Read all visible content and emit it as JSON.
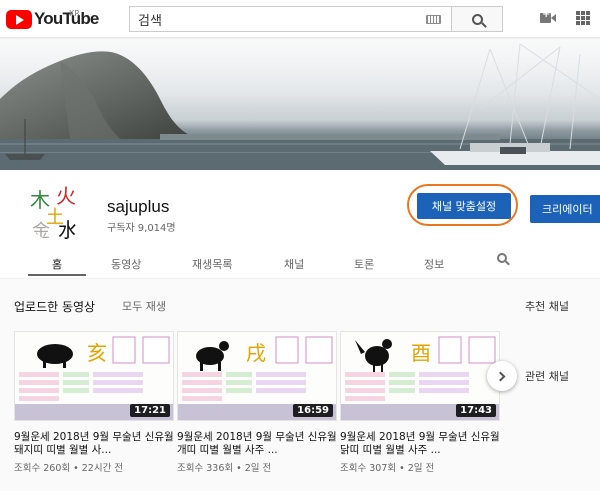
{
  "header": {
    "logo_text": "YouTube",
    "region": "KR",
    "search_placeholder": "검색"
  },
  "channel": {
    "name": "sajuplus",
    "subscribers": "구독자 9,014명",
    "avatar_chars": [
      "木",
      "火",
      "土",
      "金",
      "水"
    ],
    "customize_button": "채널 맞춤설정",
    "creator_button": "크리에이터"
  },
  "tabs": [
    "홈",
    "동영상",
    "재생목록",
    "채널",
    "토론",
    "정보"
  ],
  "section": {
    "title": "업로드한 동영상",
    "play_all": "모두 재생"
  },
  "sidebar": {
    "featured_channels": "추천 채널",
    "related_channels": "관련 채널"
  },
  "videos": [
    {
      "title": "9월운세 2018년 9월 무술년 신유월 돼지띠 띠별 월별 사...",
      "meta": "조회수 260회 • 22시간 전",
      "duration": "17:21",
      "animal": "pig",
      "char": "亥"
    },
    {
      "title": "9월운세 2018년 9월 무술년 신유월 개띠 띠별 월별 사주 ...",
      "meta": "조회수 336회 • 2일 전",
      "duration": "16:59",
      "animal": "dog",
      "char": "戌"
    },
    {
      "title": "9월운세 2018년 9월 무술년 신유월 닭띠 띠별 월별 사주 ...",
      "meta": "조회수 307회 • 2일 전",
      "duration": "17:43",
      "animal": "rooster",
      "char": "酉"
    }
  ],
  "colors": {
    "brand_red": "#ff0000",
    "button_blue": "#1c62b9",
    "highlight_orange": "#e87722"
  }
}
